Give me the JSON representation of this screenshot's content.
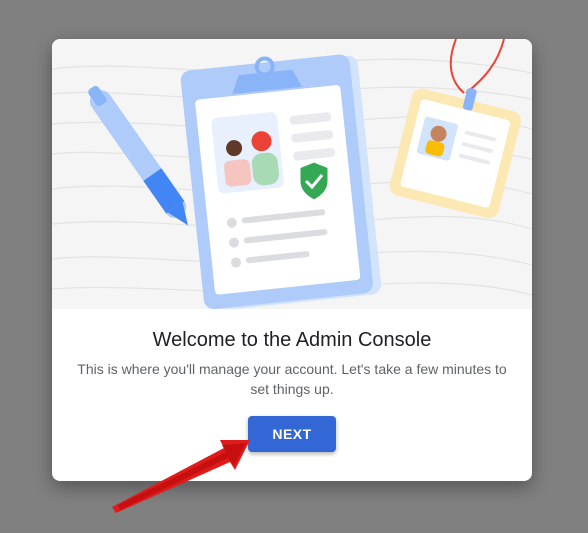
{
  "dialog": {
    "title": "Welcome to the Admin Console",
    "subtitle": "This is where you'll manage your account. Let's take a few minutes to set things up.",
    "next_label": "NEXT"
  },
  "colors": {
    "primary_button": "#3367d6",
    "annotation_arrow": "#e01b1b",
    "backdrop": "#808080"
  },
  "illustration": {
    "icons": [
      "pen-icon",
      "clipboard-icon",
      "id-badge-icon",
      "shield-check-icon"
    ]
  }
}
